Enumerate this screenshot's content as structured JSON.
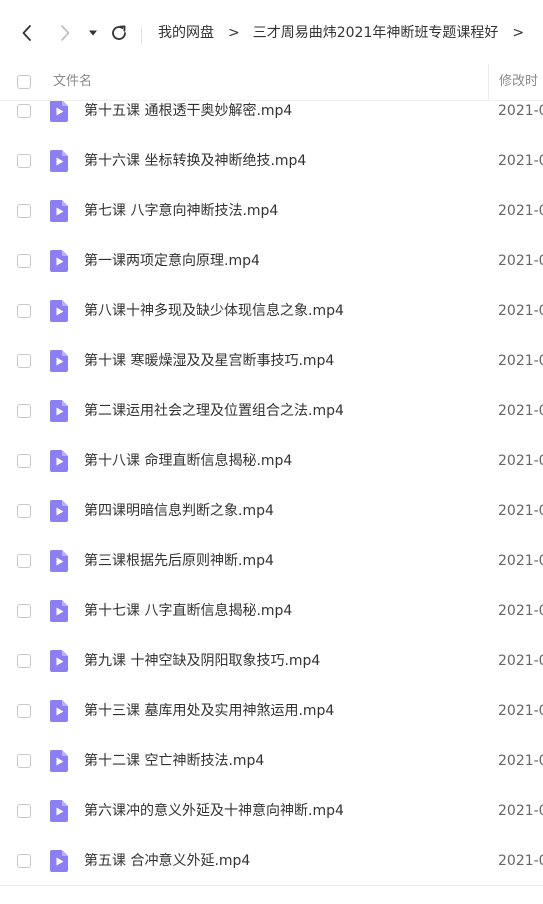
{
  "breadcrumb": {
    "items": [
      "我的网盘",
      "三才周易曲炜2021年神断班专题课程好"
    ],
    "separator": ">",
    "overflow_separator": ">"
  },
  "columns": {
    "name": "文件名",
    "modified": "修改时"
  },
  "colors": {
    "file_icon": "#8b7ff2",
    "text": "#333333",
    "muted": "#8a8a8a"
  },
  "files": [
    {
      "name": "第十五课 通根透干奥妙解密.mp4",
      "date": "2021-0",
      "icon": "video-file-icon"
    },
    {
      "name": "第十六课 坐标转换及神断绝技.mp4",
      "date": "2021-0",
      "icon": "video-file-icon"
    },
    {
      "name": "第七课 八字意向神断技法.mp4",
      "date": "2021-0",
      "icon": "video-file-icon"
    },
    {
      "name": "第一课两项定意向原理.mp4",
      "date": "2021-0",
      "icon": "video-file-icon"
    },
    {
      "name": "第八课十神多现及缺少体现信息之象.mp4",
      "date": "2021-0",
      "icon": "video-file-icon"
    },
    {
      "name": "第十课 寒暖燥湿及及星宫断事技巧.mp4",
      "date": "2021-0",
      "icon": "video-file-icon"
    },
    {
      "name": "第二课运用社会之理及位置组合之法.mp4",
      "date": "2021-0",
      "icon": "video-file-icon"
    },
    {
      "name": "第十八课 命理直断信息揭秘.mp4",
      "date": "2021-0",
      "icon": "video-file-icon"
    },
    {
      "name": "第四课明暗信息判断之象.mp4",
      "date": "2021-0",
      "icon": "video-file-icon"
    },
    {
      "name": "第三课根据先后原则神断.mp4",
      "date": "2021-0",
      "icon": "video-file-icon"
    },
    {
      "name": "第十七课 八字直断信息揭秘.mp4",
      "date": "2021-0",
      "icon": "video-file-icon"
    },
    {
      "name": "第九课 十神空缺及阴阳取象技巧.mp4",
      "date": "2021-0",
      "icon": "video-file-icon"
    },
    {
      "name": "第十三课 墓库用处及实用神煞运用.mp4",
      "date": "2021-0",
      "icon": "video-file-icon"
    },
    {
      "name": "第十二课 空亡神断技法.mp4",
      "date": "2021-0",
      "icon": "video-file-icon"
    },
    {
      "name": "第六课冲的意义外延及十神意向神断.mp4",
      "date": "2021-0",
      "icon": "video-file-icon"
    },
    {
      "name": "第五课 合冲意义外延.mp4",
      "date": "2021-0",
      "icon": "video-file-icon"
    }
  ]
}
